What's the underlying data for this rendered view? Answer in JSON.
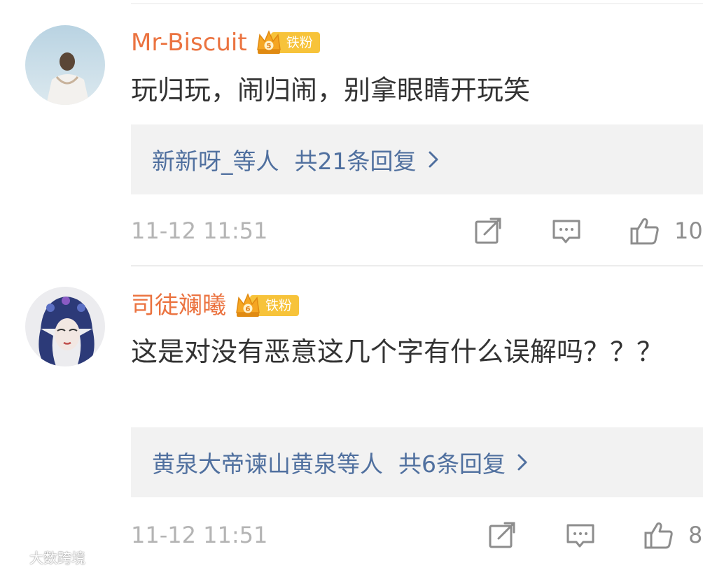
{
  "comments": [
    {
      "username": "Mr-Biscuit",
      "badge_level": "5",
      "badge_label": "铁粉",
      "text": "玩归玩，闹归闹，别拿眼睛开玩笑",
      "reply_names": "新新呀_等人",
      "reply_count": "共21条回复",
      "timestamp": "11-12 11:51",
      "like_count": "10"
    },
    {
      "username": "司徒斓曦",
      "badge_level": "6",
      "badge_label": "铁粉",
      "text": "这是对没有恶意这几个字有什么误解吗？？？",
      "reply_names": "黄泉大帝谏山黄泉等人",
      "reply_count": "共6条回复",
      "timestamp": "11-12 11:51",
      "like_count": "8"
    }
  ],
  "watermark": "大数跨境",
  "icons": {
    "share": "share-icon",
    "comment": "comment-icon",
    "like": "thumbs-up-icon",
    "chevron": "chevron-right-icon"
  },
  "colors": {
    "username": "#eb7340",
    "badge": "#f7c33a",
    "link": "#50709f",
    "reply_bg": "#f2f2f2",
    "muted": "#b4b4b4"
  }
}
